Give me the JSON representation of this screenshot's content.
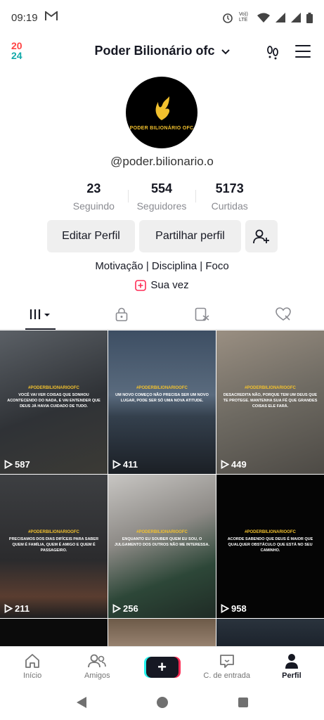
{
  "status_bar": {
    "time": "09:19",
    "mail_icon": "gmail-icon",
    "icons": [
      "alarm-icon",
      "volte-icon",
      "wifi-icon",
      "signal-icon",
      "signal-icon",
      "battery-icon"
    ],
    "volte_text": "Vo)) LTE"
  },
  "header": {
    "badge_line1": "20",
    "badge_line2": "24",
    "account_name": "Poder Bilionário ofc"
  },
  "profile": {
    "avatar_text": "PODER BILIONÁRIO OFC",
    "username": "@poder.bilionario.o",
    "stats": [
      {
        "value": "23",
        "label": "Seguindo"
      },
      {
        "value": "554",
        "label": "Seguidores"
      },
      {
        "value": "5173",
        "label": "Curtidas"
      }
    ],
    "edit_label": "Editar Perfil",
    "share_label": "Partilhar perfil",
    "bio": "Motivação | Disciplina | Foco",
    "your_turn": "Sua vez"
  },
  "tabs": [
    "videos-tab",
    "private-tab",
    "reposts-tab",
    "liked-tab"
  ],
  "videos": [
    {
      "views": "587",
      "tag": "#PODERBILIONARIOOFC",
      "caption": "Você vai ver coisas que sonhou acontecendo do nada, e vai entender que Deus já havia cuidado de tudo."
    },
    {
      "views": "411",
      "tag": "#PODERBILIONARIOOFC",
      "caption": "Um novo começo não precisa ser um novo lugar, pode ser só uma nova atitude."
    },
    {
      "views": "449",
      "tag": "#PODERBILIONARIOOFC",
      "caption": "Desacredita não, porque tem um Deus que te protege. Mantenha sua fé que grandes coisas ele fará."
    },
    {
      "views": "211",
      "tag": "#PODERBILIONARIOOFC",
      "caption": "Precisamos dos dias difíceis para saber quem é família, quem é amigo e quem é passageiro."
    },
    {
      "views": "256",
      "tag": "#PODERBILIONARIOOFC",
      "caption": "Enquanto eu souber quem eu sou, o julgamento dos outros não me interessa."
    },
    {
      "views": "958",
      "tag": "#PODERBILIONARIOOFC",
      "caption": "Acorde sabendo que Deus é maior que qualquer obstáculo que está no seu caminho."
    }
  ],
  "bottom_nav": {
    "home": "Início",
    "friends": "Amigos",
    "create": "+",
    "inbox": "C. de entrada",
    "profile": "Perfil"
  }
}
